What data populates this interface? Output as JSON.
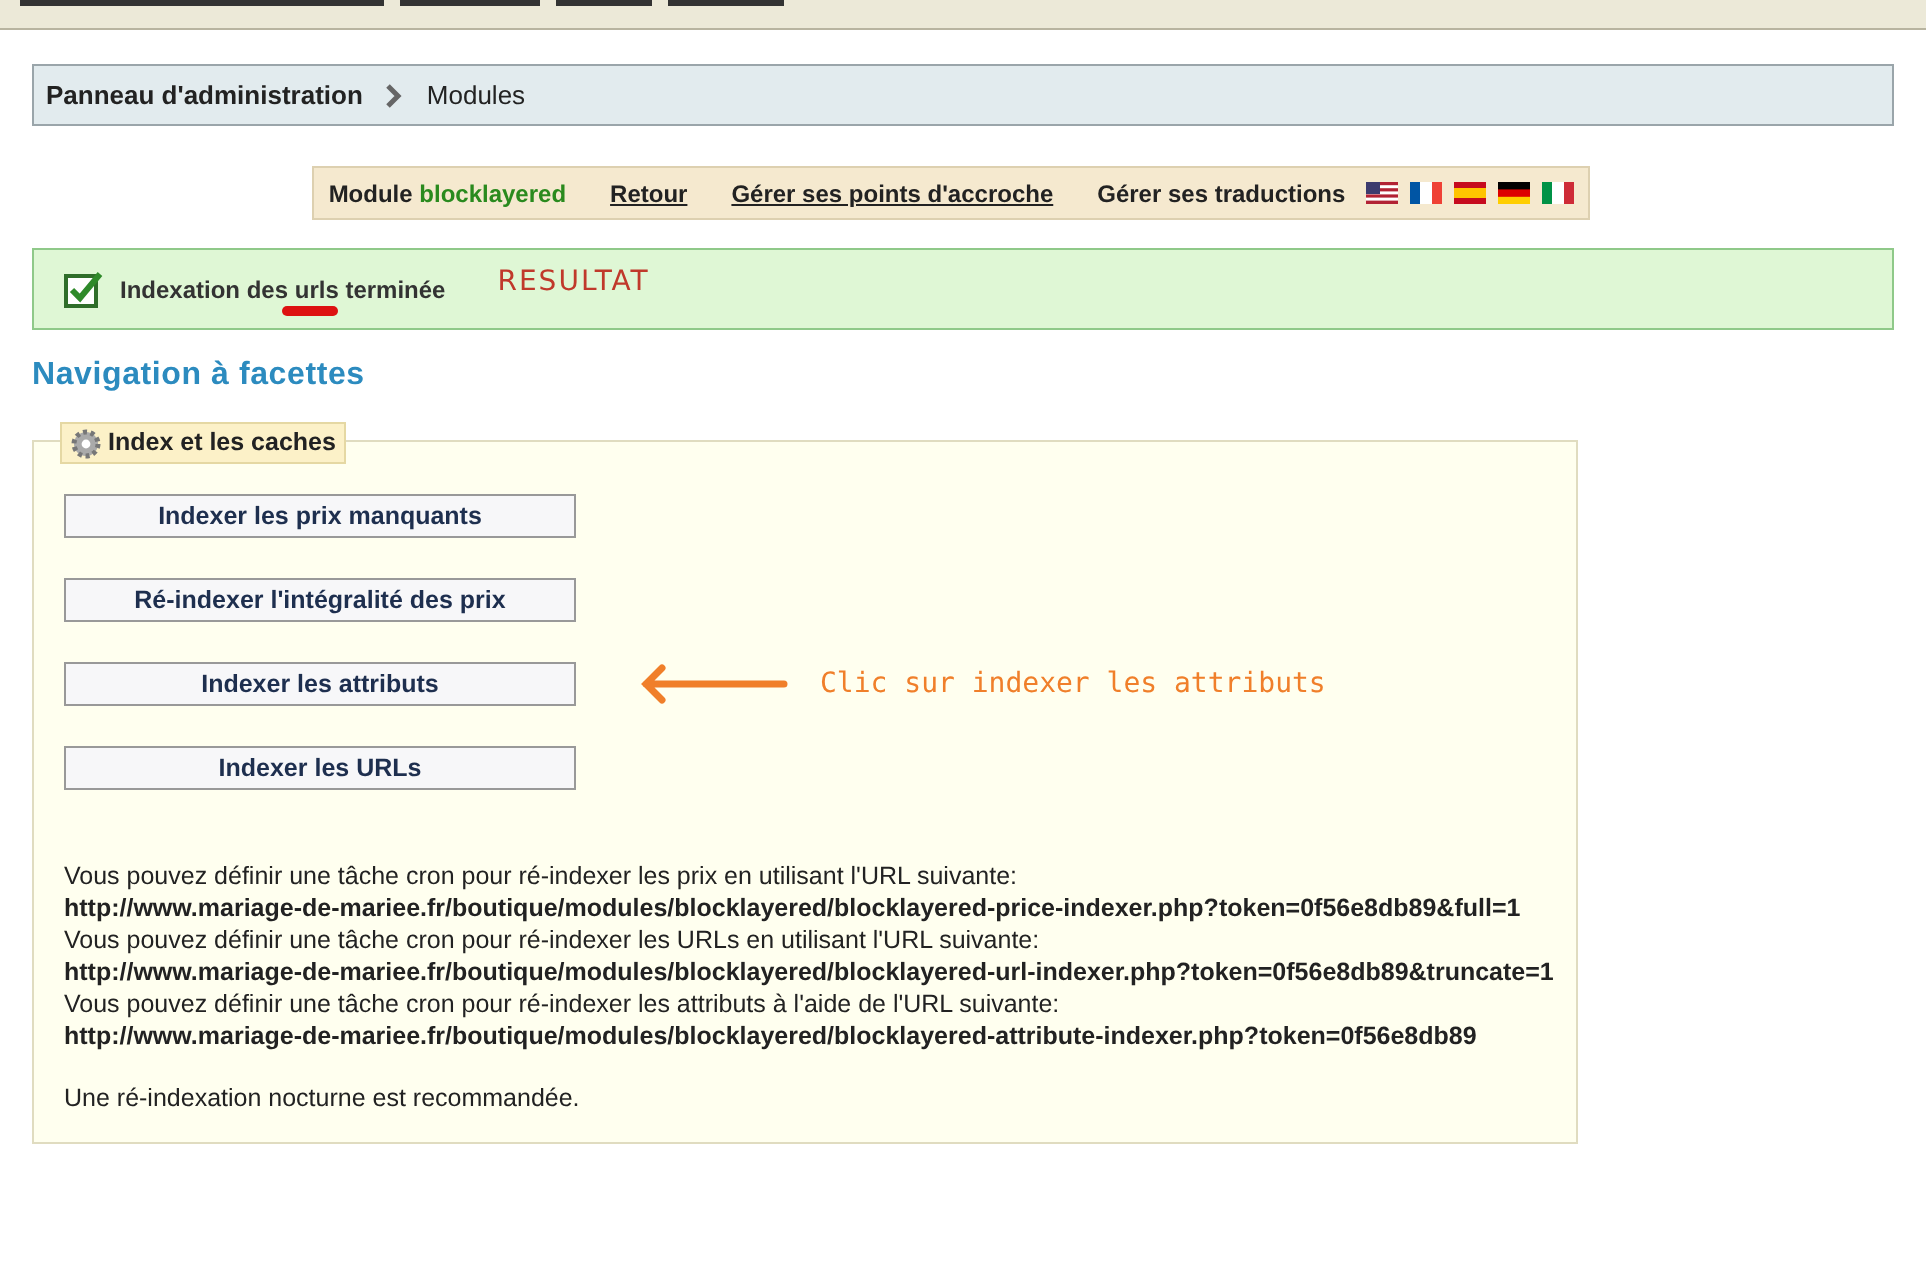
{
  "breadcrumb": {
    "items": [
      "Panneau d'administration",
      "Modules"
    ]
  },
  "module_bar": {
    "label": "Module",
    "module_name": "blocklayered",
    "links": [
      "Retour",
      "Gérer ses points d'accroche"
    ],
    "translations_label": "Gérer ses traductions",
    "flags": [
      {
        "kind": "us"
      },
      {
        "kind": "fr"
      },
      {
        "kind": "es"
      },
      {
        "kind": "de"
      },
      {
        "kind": "it"
      }
    ]
  },
  "success": {
    "message": "Indexation des **urls** terminée",
    "annotation": "RESULTAT"
  },
  "title": "Navigation à facettes",
  "fieldset": {
    "legend": "Index et les caches",
    "buttons": [
      {
        "label": "Indexer les prix manquants"
      },
      {
        "label": "Ré-indexer l'intégralité des prix"
      },
      {
        "label": "Indexer les attributs",
        "annotation": "Clic sur indexer les attributs"
      },
      {
        "label": "Indexer les URLs"
      }
    ],
    "cron": [
      {
        "text": "Vous pouvez définir une tâche cron pour ré-indexer les prix en utilisant l'URL suivante:",
        "url": "http://www.mariage-de-mariee.fr/boutique/modules/blocklayered/blocklayered-price-indexer.php?token=0f56e8db89&full=1"
      },
      {
        "text": "Vous pouvez définir une tâche cron pour ré-indexer les URLs en utilisant l'URL suivante:",
        "url": "http://www.mariage-de-mariee.fr/boutique/modules/blocklayered/blocklayered-url-indexer.php?token=0f56e8db89&truncate=1"
      },
      {
        "text": "Vous pouvez définir une tâche cron pour ré-indexer les attributs à l'aide de l'URL suivante:",
        "url": "http://www.mariage-de-mariee.fr/boutique/modules/blocklayered/blocklayered-attribute-indexer.php?token=0f56e8db89"
      }
    ],
    "note": "Une ré-indexation nocturne est recommandée."
  }
}
